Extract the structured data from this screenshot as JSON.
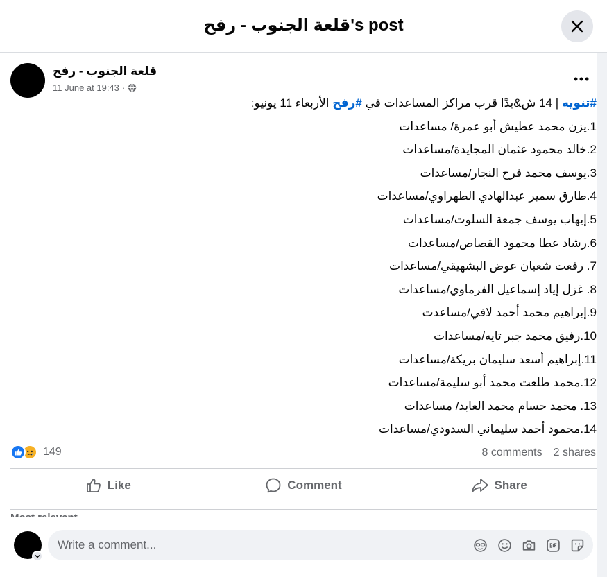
{
  "header": {
    "title": "قلعة الجنوب - رفح's post"
  },
  "post": {
    "author": "قلعة الجنوب - رفح",
    "timestamp": "11 June at 19:43",
    "separator": "·",
    "intro": {
      "tag1": "#تنويه",
      "part1": " | 14 ش&يدًا قرب مراكز المساعدات في ",
      "tag2": "#رفح",
      "part2": " الأربعاء 11 يونيو:"
    },
    "lines": [
      "1.يزن محمد عطيش أبو عمرة/ مساعدات",
      "2.خالد محمود عثمان المجايدة/مساعدات",
      "3.يوسف محمد فرح النجار/مساعدات",
      "4.طارق سمير عبدالهادي الطهراوي/مساعدات",
      "5.إيهاب يوسف جمعة السلوت/مساعدات",
      "6.رشاد عطا محمود القصاص/مساعدات",
      "7. رفعت شعبان عوض البشهيقي/مساعدات",
      "8. غزل إياد إسماعيل الفرماوي/مساعدات",
      "9.إبراهيم محمد أحمد لافي/مساعدت",
      "10.رفيق محمد جبر تايه/مساعدات",
      "11.إبراهيم أسعد سليمان بريكة/مساعدات",
      "12.محمد طلعت محمد أبو سليمة/مساعدات",
      "13. محمد حسام محمد العابد/ مساعدات",
      "14.محمود أحمد سليماني السدودي/مساعدات"
    ]
  },
  "stats": {
    "reactions": "149",
    "comments": "8 comments",
    "shares": "2 shares"
  },
  "actions": {
    "like": "Like",
    "comment": "Comment",
    "share": "Share"
  },
  "comments": {
    "sort_label": "Most relevant",
    "placeholder": "Write a comment..."
  },
  "colors": {
    "hashtag": "#0064d1",
    "like": "#1877f2",
    "sad": "#f7b125",
    "muted": "#65676b"
  },
  "icons": [
    "close-icon",
    "globe-icon",
    "more-icon",
    "like-icon",
    "comment-icon",
    "share-icon",
    "avatar-icon",
    "sticker-icon",
    "emoji-icon",
    "camera-icon",
    "gif-icon"
  ]
}
